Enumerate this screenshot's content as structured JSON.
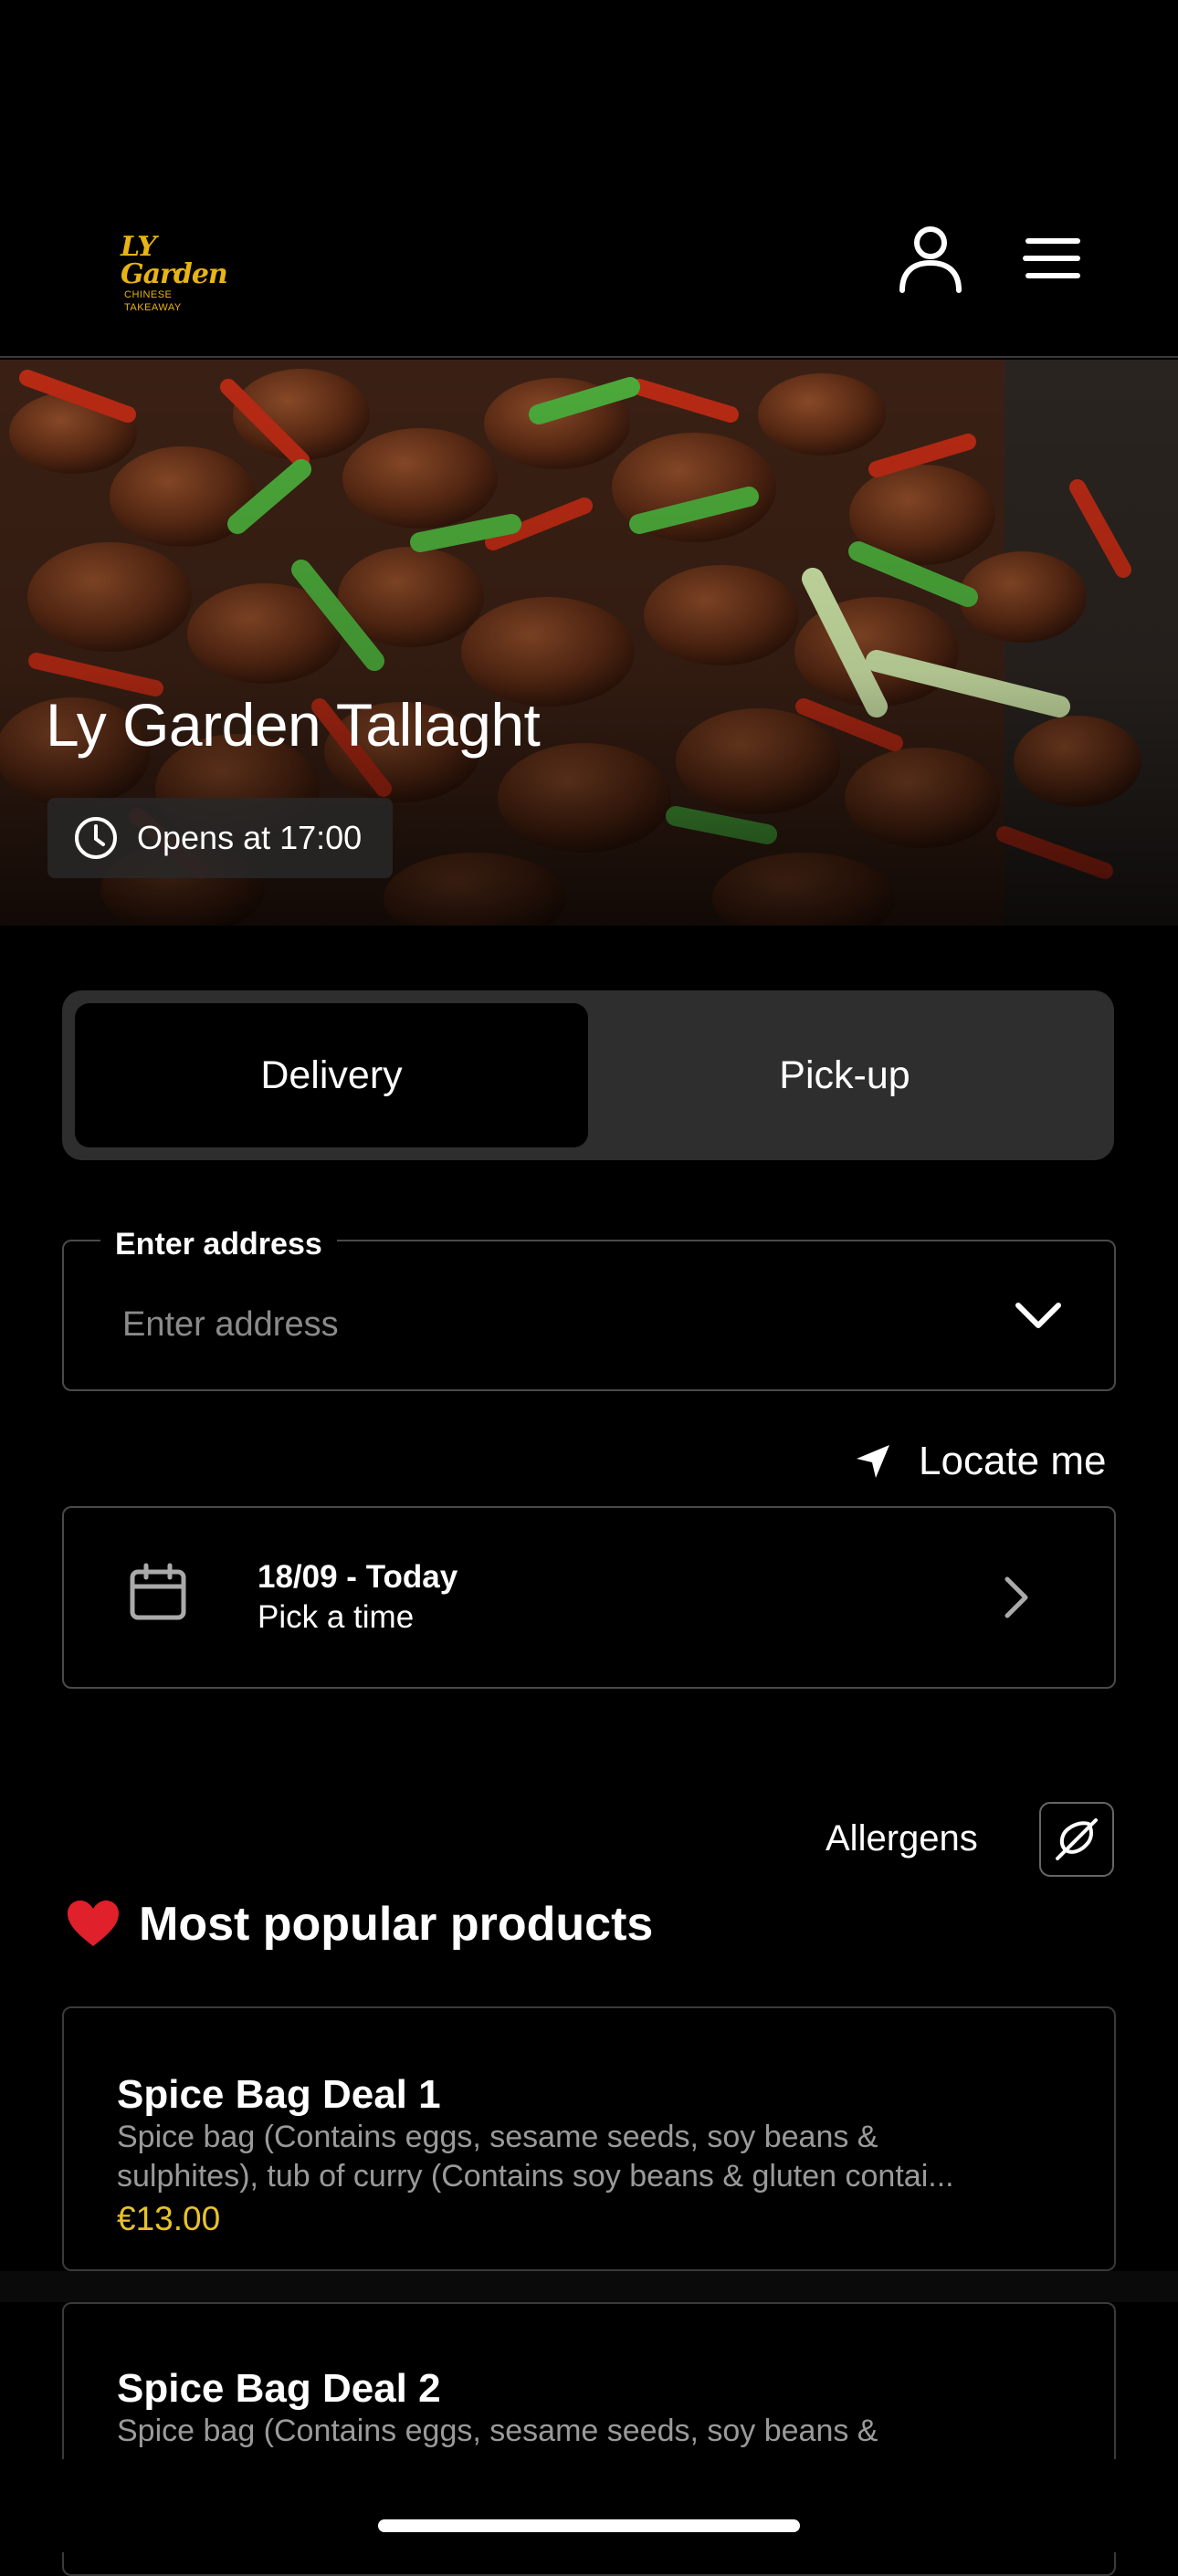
{
  "header": {
    "logo_main": "LY Garden",
    "logo_sub": "CHINESE TAKEAWAY",
    "account_icon": "user-icon",
    "menu_icon": "hamburger-menu-icon"
  },
  "hero": {
    "restaurant_name": "Ly Garden Tallaght",
    "hours_text": "Opens at 17:00",
    "hours_icon": "clock-icon"
  },
  "order_mode": {
    "options": [
      "Delivery",
      "Pick-up"
    ],
    "selected": "Delivery"
  },
  "address": {
    "legend": "Enter address",
    "placeholder": "Enter address",
    "value": ""
  },
  "locate": {
    "label": "Locate me",
    "icon": "location-arrow-icon"
  },
  "schedule": {
    "date_label": "18/09 - Today",
    "time_label": "Pick a time",
    "icon": "calendar-icon"
  },
  "allergens": {
    "label": "Allergens",
    "icon": "allergen-filter-icon"
  },
  "popular": {
    "title": "Most popular products",
    "icon": "heart-icon",
    "products": [
      {
        "name": "Spice Bag Deal 1",
        "description_line1": "Spice bag (Contains eggs, sesame seeds, soy beans &",
        "description_line2": "sulphites), tub of curry (Contains soy beans & gluten contai...",
        "price": "€13.00"
      },
      {
        "name": "Spice Bag Deal 2",
        "description_line1": "Spice bag (Contains eggs, sesame seeds, soy beans &",
        "description_line2": ""
      }
    ]
  },
  "colors": {
    "background": "#000000",
    "accent_gold": "#e8b315",
    "price_yellow": "#e8c22a",
    "toggle_bg": "#2e2e2e"
  }
}
